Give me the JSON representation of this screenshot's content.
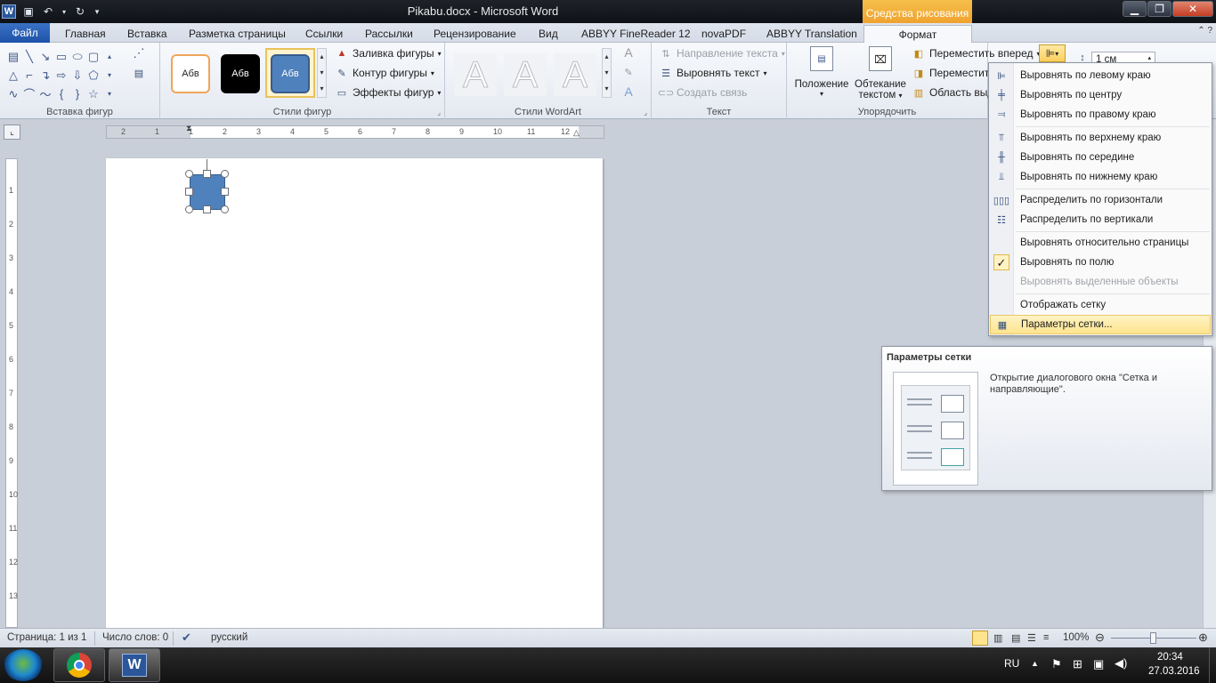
{
  "window": {
    "title": "Pikabu.docx - Microsoft Word",
    "context_tab": "Средства рисования"
  },
  "tabs": {
    "file": "Файл",
    "items": [
      "Главная",
      "Вставка",
      "Разметка страницы",
      "Ссылки",
      "Рассылки",
      "Рецензирование",
      "Вид",
      "ABBYY FineReader 12",
      "novaPDF",
      "ABBYY Translation"
    ],
    "format": "Формат"
  },
  "ribbon": {
    "insert_shapes_label": "Вставка фигур",
    "styles": {
      "label": "Стили фигур",
      "samples": [
        "Абв",
        "Абв",
        "Абв"
      ],
      "fill": "Заливка фигуры",
      "outline": "Контур фигуры",
      "effects": "Эффекты фигур"
    },
    "wordart_label": "Стили WordArt",
    "wordart_sample": "A",
    "text": {
      "label": "Текст",
      "direction": "Направление текста",
      "align": "Выровнять текст",
      "link": "Создать связь"
    },
    "arrange": {
      "label": "Упорядочить",
      "position": "Положение",
      "wrap_line1": "Обтекание",
      "wrap_line2": "текстом",
      "forward": "Переместить вперед",
      "backward": "Переместить",
      "area": "Область выд"
    },
    "size": {
      "height": "1 см"
    }
  },
  "align_menu": {
    "items": [
      "Выровнять по левому краю",
      "Выровнять по центру",
      "Выровнять по правому краю",
      "Выровнять по верхнему краю",
      "Выровнять по середине",
      "Выровнять по нижнему краю",
      "Распределить по горизонтали",
      "Распределить по вертикали",
      "Выровнять относительно страницы",
      "Выровнять по полю",
      "Выровнять выделенные объекты",
      "Отображать сетку",
      "Параметры сетки..."
    ],
    "checked_item": "Выровнять по полю",
    "highlighted_item": "Параметры сетки..."
  },
  "tooltip": {
    "title": "Параметры сетки",
    "description": "Открытие диалогового окна \"Сетка и направляющие\"."
  },
  "ruler": {
    "h_labels": [
      "2",
      "1",
      "1",
      "2",
      "3",
      "4",
      "5",
      "6",
      "7",
      "8",
      "9",
      "10",
      "11",
      "12"
    ],
    "v_labels": [
      "1",
      "2",
      "3",
      "4",
      "5",
      "6",
      "7",
      "8",
      "9",
      "10",
      "11",
      "12",
      "13"
    ]
  },
  "status": {
    "page": "Страница: 1 из 1",
    "words": "Число слов: 0",
    "language": "русский",
    "zoom": "100%"
  },
  "taskbar": {
    "lang": "RU",
    "time": "20:34",
    "date": "27.03.2016"
  },
  "colors": {
    "accent": "#2b579a",
    "shape_fill": "#4f81bd",
    "context_tab": "#f0a22e",
    "highlight": "#ffe48e"
  }
}
